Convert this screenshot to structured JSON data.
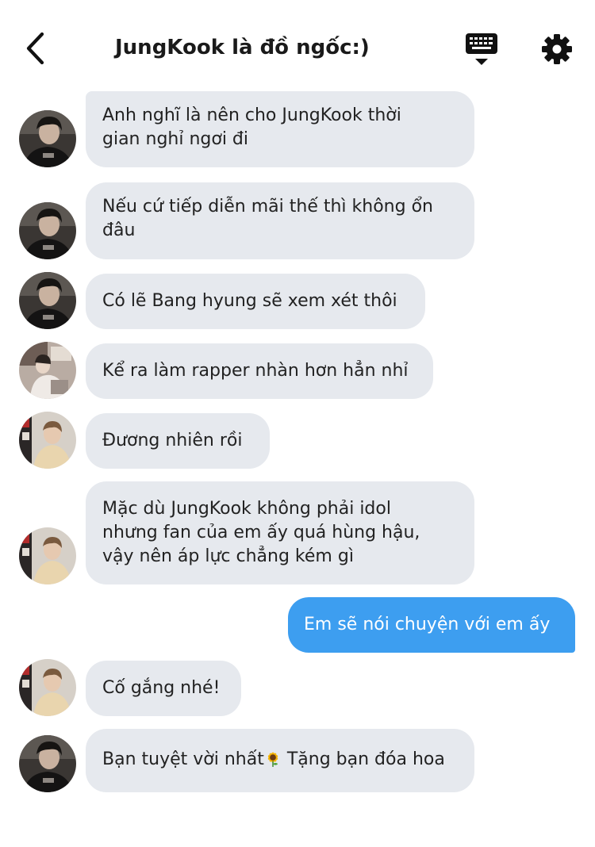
{
  "header": {
    "title": "JungKook là đồ ngốc:)",
    "back_icon": "chevron-left-icon",
    "keyboard_icon": "keyboard-icon",
    "settings_icon": "gear-icon"
  },
  "colors": {
    "received_bubble": "#e6e9ee",
    "sent_bubble": "#3d9ef0",
    "text": "#222222"
  },
  "messages": [
    {
      "direction": "received",
      "avatar": "avatar-a",
      "text_lines": [
        "Anh nghĩ là nên cho JungKook thời",
        "gian nghỉ ngơi đi"
      ]
    },
    {
      "direction": "received",
      "avatar": "avatar-a",
      "text_lines": [
        "Nếu cứ tiếp diễn mãi thế thì không ổn",
        "đâu"
      ]
    },
    {
      "direction": "received",
      "avatar": "avatar-a",
      "text_lines": [
        "Có lẽ Bang hyung sẽ xem xét thôi"
      ]
    },
    {
      "direction": "received",
      "avatar": "avatar-b",
      "text_lines": [
        "Kể ra làm rapper nhàn hơn hẳn nhỉ"
      ]
    },
    {
      "direction": "received",
      "avatar": "avatar-c",
      "text_lines": [
        "Đương nhiên rồi"
      ]
    },
    {
      "direction": "received",
      "avatar": "avatar-c",
      "text_lines": [
        "Mặc dù JungKook không phải idol",
        "nhưng fan của em ấy quá hùng hậu,",
        "vậy nên áp lực chẳng kém gì"
      ]
    },
    {
      "direction": "sent",
      "text_lines": [
        "Em sẽ nói chuyện với em ấy"
      ]
    },
    {
      "direction": "received",
      "avatar": "avatar-c",
      "text_lines": [
        "Cố gắng nhé!"
      ]
    },
    {
      "direction": "received",
      "avatar": "avatar-a",
      "text_before_emoji": "Bạn tuyệt vời nhất",
      "emoji": "sunflower-icon",
      "text_after_emoji": " Tặng bạn đóa hoa"
    }
  ]
}
